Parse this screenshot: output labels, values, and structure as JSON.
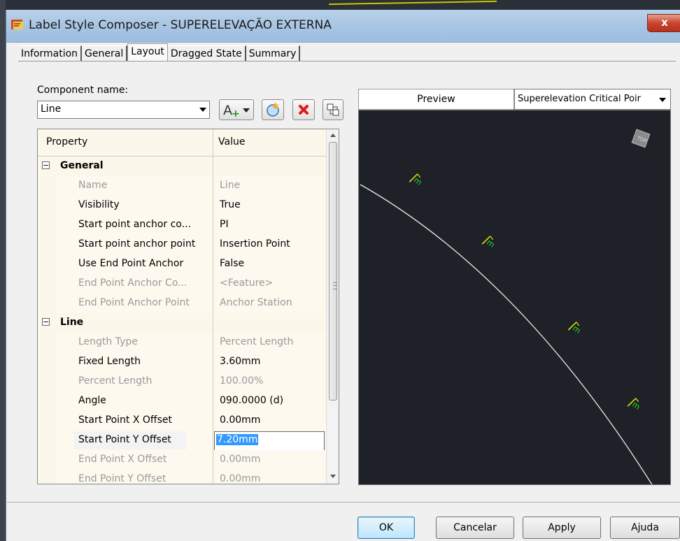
{
  "window": {
    "title": "Label Style Composer - SUPERELEVAÇÃO EXTERNA",
    "close_label": "x"
  },
  "tabs": [
    {
      "label": "Information",
      "active": false
    },
    {
      "label": "General",
      "active": false
    },
    {
      "label": "Layout",
      "active": true
    },
    {
      "label": "Dragged State",
      "active": false
    },
    {
      "label": "Summary",
      "active": false
    }
  ],
  "component": {
    "label": "Component name:",
    "value": "Line"
  },
  "toolbar": {
    "new_icon": "text-add-icon",
    "copy_icon": "copy-component-icon",
    "delete_icon": "delete-icon",
    "draw_order_icon": "draw-order-icon"
  },
  "grid": {
    "col_property": "Property",
    "col_value": "Value",
    "rows": [
      {
        "type": "category",
        "name": "General",
        "value": ""
      },
      {
        "type": "prop",
        "name": "Name",
        "value": "Line",
        "dim": true
      },
      {
        "type": "prop",
        "name": "Visibility",
        "value": "True",
        "dim": false
      },
      {
        "type": "prop",
        "name": "Start point anchor co...",
        "value": "PI",
        "dim": false
      },
      {
        "type": "prop",
        "name": "Start point anchor point",
        "value": "Insertion Point",
        "dim": false
      },
      {
        "type": "prop",
        "name": "Use End Point Anchor",
        "value": "False",
        "dim": false
      },
      {
        "type": "prop",
        "name": "End Point Anchor Co...",
        "value": "<Feature>",
        "dim": true
      },
      {
        "type": "prop",
        "name": "End Point Anchor Point",
        "value": "Anchor Station",
        "dim": true
      },
      {
        "type": "category",
        "name": "Line",
        "value": ""
      },
      {
        "type": "prop",
        "name": "Length Type",
        "value": "Percent Length",
        "dim": true
      },
      {
        "type": "prop",
        "name": "Fixed Length",
        "value": "3.60mm",
        "dim": false
      },
      {
        "type": "prop",
        "name": "Percent Length",
        "value": "100.00%",
        "dim": true
      },
      {
        "type": "prop",
        "name": "Angle",
        "value": "090.0000 (d)",
        "dim": false
      },
      {
        "type": "prop",
        "name": "Start Point X Offset",
        "value": "0.00mm",
        "dim": false
      },
      {
        "type": "edit",
        "name": "Start Point Y Offset",
        "value": "7.20mm",
        "dim": false
      },
      {
        "type": "prop",
        "name": "End Point X Offset",
        "value": "0.00mm",
        "dim": true
      },
      {
        "type": "prop",
        "name": "End Point Y Offset",
        "value": "0.00mm",
        "dim": true
      }
    ]
  },
  "preview": {
    "label": "Preview",
    "selector_value": "Superelevation Critical Poir",
    "label_text": "m",
    "line_color": "#e8e8e8",
    "label_color": "#22dd22",
    "tick_color": "#e8e800",
    "background": "#1e2127"
  },
  "buttons": {
    "ok": "OK",
    "cancel": "Cancelar",
    "apply": "Apply",
    "help": "Ajuda"
  }
}
